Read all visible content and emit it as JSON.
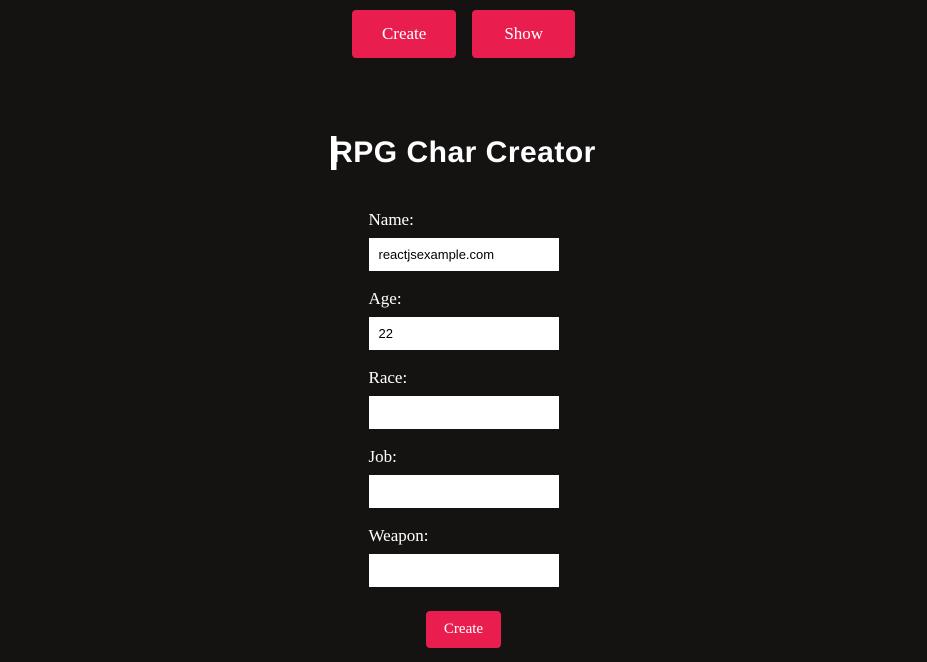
{
  "nav": {
    "create_label": "Create",
    "show_label": "Show"
  },
  "title": "RPG Char Creator",
  "form": {
    "fields": [
      {
        "label": "Name:",
        "value": "reactjsexample.com"
      },
      {
        "label": "Age:",
        "value": "22"
      },
      {
        "label": "Race:",
        "value": ""
      },
      {
        "label": "Job:",
        "value": ""
      },
      {
        "label": "Weapon:",
        "value": ""
      }
    ],
    "submit_label": "Create"
  },
  "colors": {
    "background": "#151212",
    "accent": "#e91e4e",
    "text": "#ffffff"
  }
}
